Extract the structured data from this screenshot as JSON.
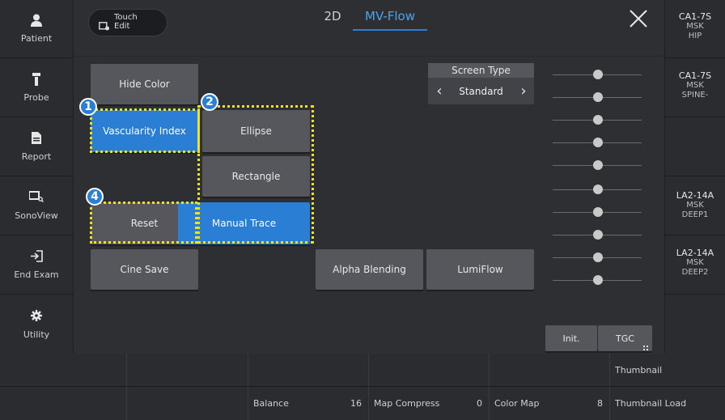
{
  "sidebar": {
    "items": [
      {
        "icon": "person-icon",
        "label": "Patient"
      },
      {
        "icon": "probe-icon",
        "label": "Probe"
      },
      {
        "icon": "report-icon",
        "label": "Report"
      },
      {
        "icon": "sonoview-icon",
        "label": "SonoView"
      },
      {
        "icon": "end-exam-icon",
        "label": "End Exam"
      },
      {
        "icon": "gear-icon",
        "label": "Utility"
      }
    ]
  },
  "header": {
    "touch_edit_line1": "Touch",
    "touch_edit_line2": "Edit",
    "tab_2d": "2D",
    "tab_mvflow": "MV-Flow",
    "close_glyph": "✕"
  },
  "buttons": {
    "hide_color": "Hide Color",
    "vascularity_index": "Vascularity Index",
    "ellipse": "Ellipse",
    "rectangle": "Rectangle",
    "reset": "Reset",
    "manual_trace": "Manual Trace",
    "cine_save": "Cine Save",
    "alpha_blending": "Alpha Blending",
    "lumiflow": "LumiFlow",
    "init": "Init.",
    "tgc": "TGC"
  },
  "badges": {
    "b1": "1",
    "b2": "2",
    "b4": "4"
  },
  "screen_type": {
    "label": "Screen Type",
    "value": "Standard",
    "prev": "‹",
    "next": "›"
  },
  "probes": [
    {
      "name": "CA1-7S",
      "line2": "MSK",
      "line3": "HIP"
    },
    {
      "name": "CA1-7S",
      "line2": "MSK",
      "line3": "SPINE-"
    },
    {
      "name": "",
      "line2": "",
      "line3": ""
    },
    {
      "name": "LA2-14A",
      "line2": "MSK",
      "line3": "DEEP1"
    },
    {
      "name": "LA2-14A",
      "line2": "MSK",
      "line3": "DEEP2"
    }
  ],
  "bottom": {
    "row1": {
      "thumbnail": "Thumbnail"
    },
    "row2": {
      "balance_label": "Balance",
      "balance_value": "16",
      "map_compress_label": "Map Compress",
      "map_compress_value": "0",
      "color_map_label": "Color Map",
      "color_map_value": "8",
      "thumbnail_load": "Thumbnail Load"
    }
  },
  "colors": {
    "accent": "#2a7fd4",
    "highlight": "#f0e21a"
  }
}
